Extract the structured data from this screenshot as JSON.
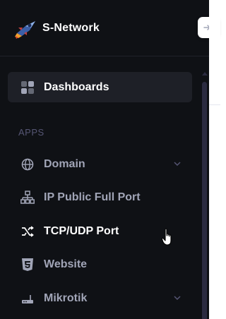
{
  "brand": {
    "name": "S-Network"
  },
  "menu": {
    "dashboards": {
      "label": "Dashboards",
      "icon": "dashboard-grid-icon"
    }
  },
  "apps_section": {
    "title": "APPS"
  },
  "apps": [
    {
      "label": "Domain",
      "icon": "globe-icon",
      "has_submenu": true
    },
    {
      "label": "IP Public Full Port",
      "icon": "network-icon",
      "has_submenu": false
    },
    {
      "label": "TCP/UDP Port",
      "icon": "shuffle-icon",
      "has_submenu": false
    },
    {
      "label": "Website",
      "icon": "html5-icon",
      "has_submenu": false
    },
    {
      "label": "Mikrotik",
      "icon": "router-icon",
      "has_submenu": true
    }
  ],
  "colors": {
    "sidebar_bg": "#0f1115",
    "active_bg": "#1e2027",
    "text_muted": "#a1a5b7",
    "text_active": "#ffffff",
    "section_title": "#565674"
  }
}
